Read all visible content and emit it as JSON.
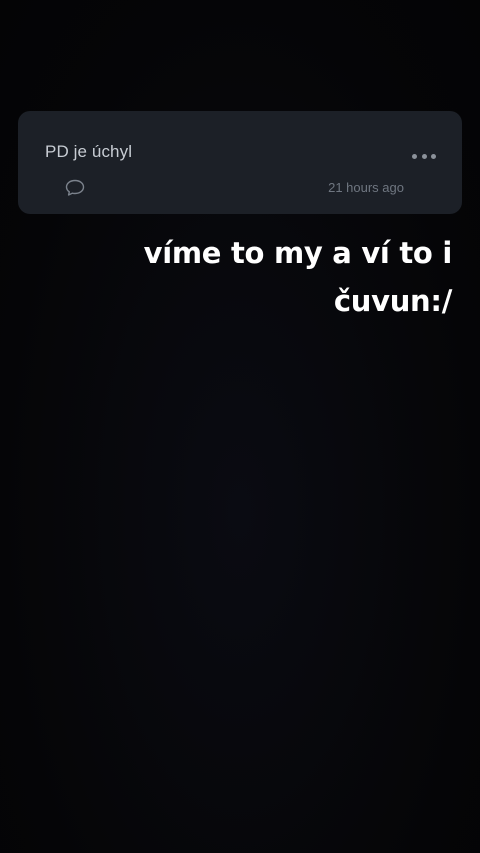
{
  "post": {
    "text": "PD je úchyl",
    "timestamp": "21 hours ago",
    "more_icon": "more-horizontal-icon",
    "comment_icon": "comment-bubble-icon"
  },
  "caption": {
    "line1": "víme to my a ví to i",
    "line2": "čuvun:/",
    "color": "#ffffff"
  },
  "colors": {
    "background": "#060608",
    "card": "#1c2027",
    "card_text": "#c7ccd3",
    "muted": "#6f7680"
  }
}
